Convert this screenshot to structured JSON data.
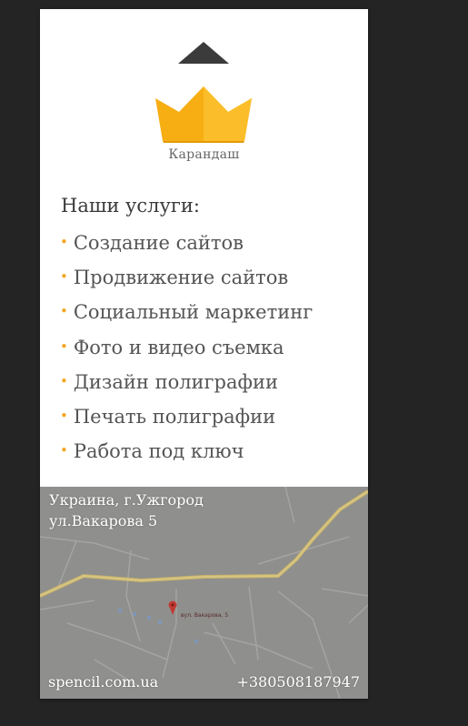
{
  "logo": {
    "name": "Карандаш",
    "icon": "crown-icon",
    "accent": "#f6ae13"
  },
  "services": {
    "title": "Наши услуги:",
    "items": [
      "Создание сайтов",
      "Продвижение сайтов",
      "Социальный маркетинг",
      "Фото и видео съемка",
      "Дизайн полиграфии",
      "Печать полиграфии",
      "Работа под ключ"
    ],
    "bullet": "•"
  },
  "map": {
    "address_line1": "Украина, г.Ужгород",
    "address_line2": "ул.Вакарова 5",
    "marker_label": "вул. Вакарова, 5"
  },
  "contacts": {
    "site": "spencil.com.ua",
    "phone": "+380508187947"
  }
}
